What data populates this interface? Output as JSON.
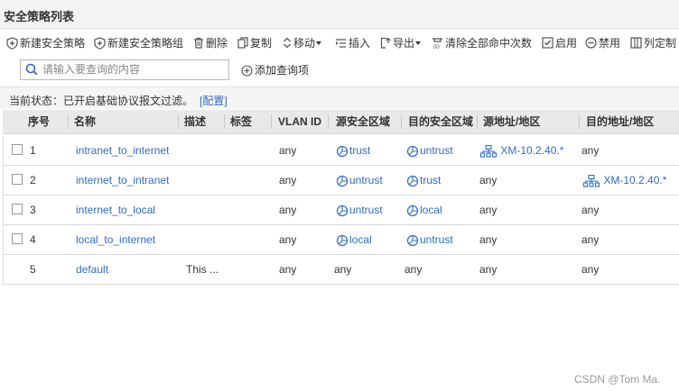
{
  "panel": {
    "title": "安全策略列表"
  },
  "toolbar": {
    "new_policy": "新建安全策略",
    "new_policy_group": "新建安全策略组",
    "delete": "删除",
    "copy": "复制",
    "move": "移动",
    "insert": "插入",
    "export": "导出",
    "clear_hits": "清除全部命中次数",
    "enable": "启用",
    "disable": "禁用",
    "column_custom": "列定制"
  },
  "search": {
    "placeholder": "请输入要查询的内容",
    "value": ""
  },
  "add_query": {
    "label": "添加查询项"
  },
  "status": {
    "text": "当前状态：已开启基础协议报文过滤。",
    "config_link": "[配置]"
  },
  "table": {
    "headers": {
      "index": "序号",
      "name": "名称",
      "description": "描述",
      "tag": "标签",
      "vlan_id": "VLAN ID",
      "src_zone": "源安全区域",
      "dst_zone": "目的安全区域",
      "src_addr": "源地址/地区",
      "dst_addr": "目的地址/地区"
    },
    "rows": [
      {
        "index": "1",
        "name": "intranet_to_internet",
        "description": "",
        "tag": "",
        "vlan_id": "any",
        "src_zone": "trust",
        "dst_zone": "untrust",
        "src_addr": "XM-10.2.40.*",
        "dst_addr": "any"
      },
      {
        "index": "2",
        "name": "internet_to_intranet",
        "description": "",
        "tag": "",
        "vlan_id": "any",
        "src_zone": "untrust",
        "dst_zone": "trust",
        "src_addr": "any",
        "dst_addr": "XM-10.2.40.*"
      },
      {
        "index": "3",
        "name": "internet_to_local",
        "description": "",
        "tag": "",
        "vlan_id": "any",
        "src_zone": "untrust",
        "dst_zone": "local",
        "src_addr": "any",
        "dst_addr": "any"
      },
      {
        "index": "4",
        "name": "local_to_internet",
        "description": "",
        "tag": "",
        "vlan_id": "any",
        "src_zone": "local",
        "dst_zone": "untrust",
        "src_addr": "any",
        "dst_addr": "any"
      },
      {
        "index": "5",
        "name": "default",
        "description": "This ...",
        "tag": "",
        "vlan_id": "any",
        "src_zone": "any",
        "dst_zone": "any",
        "src_addr": "any",
        "dst_addr": "any"
      }
    ]
  },
  "watermark": "CSDN @Tom Ma.",
  "colors": {
    "link": "#2f6cc4",
    "header_bg": "#e9e9e9",
    "title_bg": "#f3f3f3"
  }
}
